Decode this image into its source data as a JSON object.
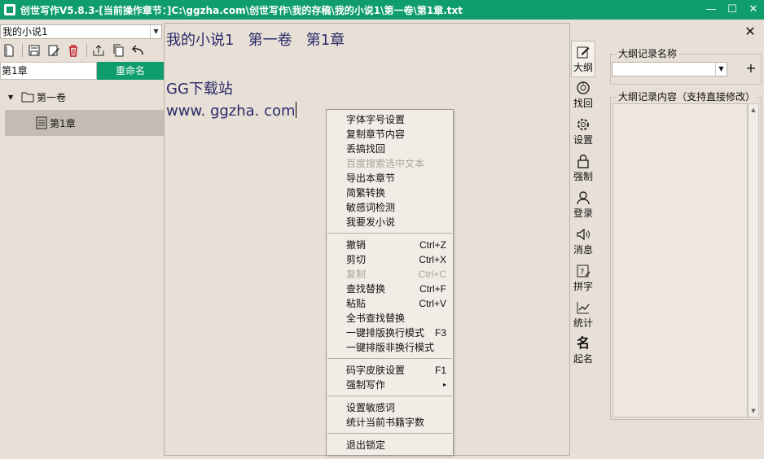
{
  "window": {
    "title": "创世写作V5.8.3-[当前操作章节：]C:\\ggzha.com\\创世写作\\我的存稿\\我的小说1\\第一卷\\第1章.txt",
    "minimize": "—",
    "maximize": "☐",
    "close": "✕"
  },
  "left": {
    "book_select": "我的小说1",
    "chapter_name": "第1章",
    "rename_label": "重命名",
    "tree": {
      "volume": "第一卷",
      "chapter": "第1章"
    }
  },
  "editor": {
    "lines": [
      "我的小说1   第一卷   第1章",
      "",
      "GG下载站",
      "www. ggzha. com"
    ]
  },
  "context_menu": {
    "group1": [
      {
        "label": "字体字号设置",
        "shortcut": "",
        "disabled": false
      },
      {
        "label": "复制章节内容",
        "shortcut": "",
        "disabled": false
      },
      {
        "label": "丢搞找回",
        "shortcut": "",
        "disabled": false
      },
      {
        "label": "百度搜索选中文本",
        "shortcut": "",
        "disabled": true
      },
      {
        "label": "导出本章节",
        "shortcut": "",
        "disabled": false
      },
      {
        "label": "简繁转换",
        "shortcut": "",
        "disabled": false
      },
      {
        "label": "敏感词检测",
        "shortcut": "",
        "disabled": false
      },
      {
        "label": "我要发小说",
        "shortcut": "",
        "disabled": false
      }
    ],
    "group2": [
      {
        "label": "撤销",
        "shortcut": "Ctrl+Z",
        "disabled": false
      },
      {
        "label": "剪切",
        "shortcut": "Ctrl+X",
        "disabled": false
      },
      {
        "label": "复制",
        "shortcut": "Ctrl+C",
        "disabled": true
      },
      {
        "label": "查找替换",
        "shortcut": "Ctrl+F",
        "disabled": false
      },
      {
        "label": "粘贴",
        "shortcut": "Ctrl+V",
        "disabled": false
      },
      {
        "label": "全书查找替换",
        "shortcut": "",
        "disabled": false
      },
      {
        "label": "一键排版换行模式",
        "shortcut": "F3",
        "disabled": false
      },
      {
        "label": "一键排版非换行模式",
        "shortcut": "",
        "disabled": false
      }
    ],
    "group3": [
      {
        "label": "码字皮肤设置",
        "shortcut": "F1",
        "disabled": false
      },
      {
        "label": "强制写作",
        "shortcut": "▸",
        "disabled": false
      }
    ],
    "group4": [
      {
        "label": "设置敏感词",
        "shortcut": "",
        "disabled": false
      },
      {
        "label": "统计当前书籍字数",
        "shortcut": "",
        "disabled": false
      }
    ],
    "group5": [
      {
        "label": "退出锁定",
        "shortcut": "",
        "disabled": false
      }
    ]
  },
  "right_bar": {
    "outline": "大纲",
    "recover": "找回",
    "settings": "设置",
    "force": "强制",
    "login": "登录",
    "message": "消息",
    "pinyin": "拼字",
    "stats": "统计",
    "naming_glyph": "名",
    "naming": "起名"
  },
  "outline_panel": {
    "name_legend": "大纲记录名称",
    "add": "+",
    "content_legend": "大纲记录内容（支持直接修改）",
    "close": "✕"
  }
}
